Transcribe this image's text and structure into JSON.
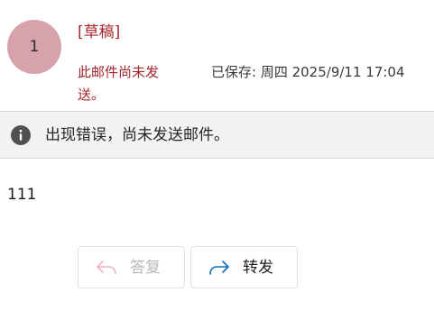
{
  "header": {
    "avatar_initial": "1",
    "draft_label": "[草稿]",
    "not_sent_notice": "此邮件尚未发送。",
    "saved_status": "已保存: 周四 2025/9/11 17:04"
  },
  "error_bar": {
    "icon": "info-icon",
    "message": "出现错误，尚未发送邮件。"
  },
  "message_body": {
    "text": "111"
  },
  "actions": {
    "reply_label": "答复",
    "reply_icon": "reply-arrow-icon",
    "reply_enabled": false,
    "forward_label": "转发",
    "forward_icon": "forward-arrow-icon",
    "forward_enabled": true
  },
  "colors": {
    "avatar_bg": "#d6a3ac",
    "draft_red": "#a4262c",
    "info_icon_bg": "#505050",
    "reply_disabled_text": "#b8b8b8",
    "reply_disabled_icon": "#e8b4cf",
    "forward_icon": "#0f6cbd"
  }
}
